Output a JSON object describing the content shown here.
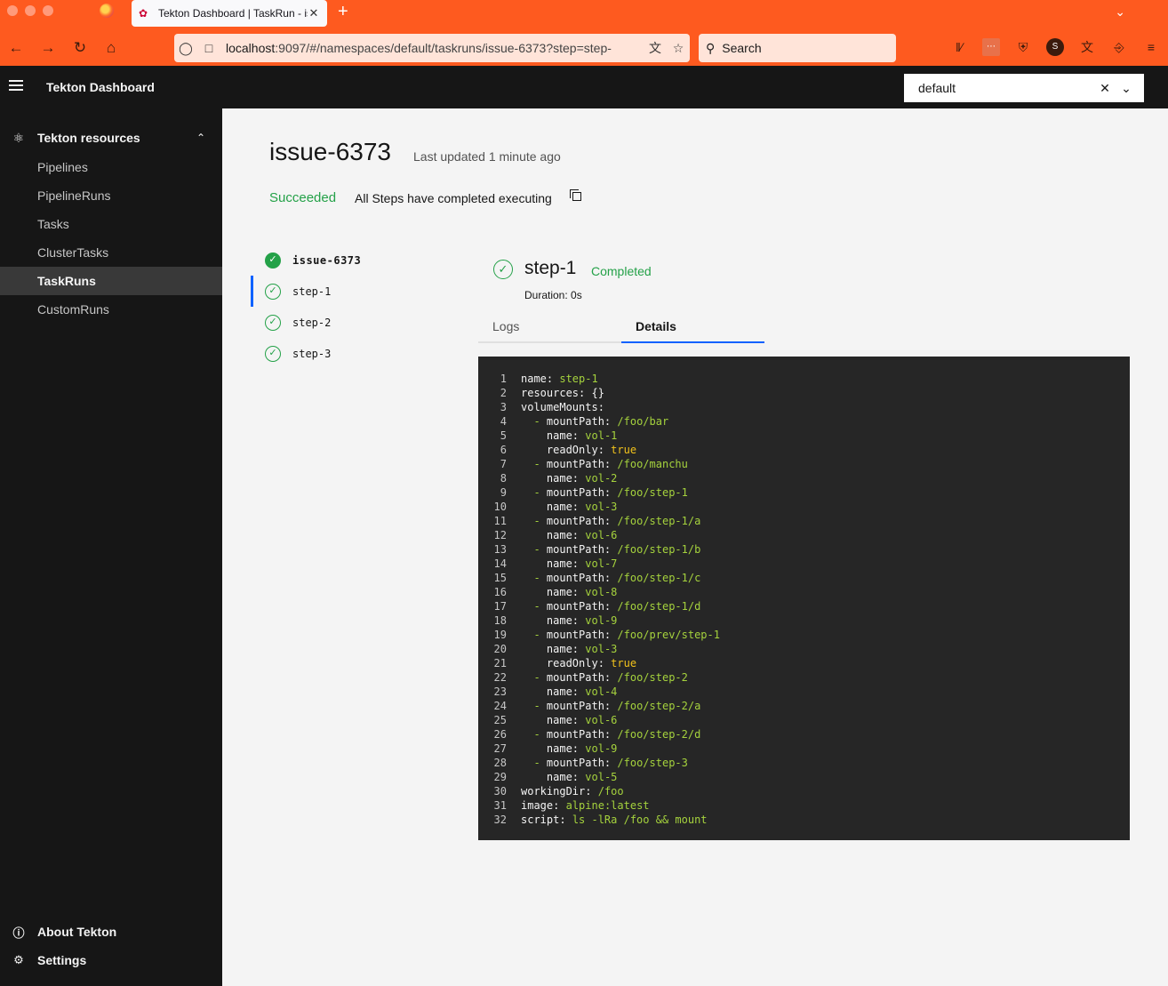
{
  "browser": {
    "tab_title": "Tekton Dashboard | TaskRun - is",
    "url_host": "localhost",
    "url_rest": ":9097/#/namespaces/default/taskruns/issue-6373?step=step-",
    "search_placeholder": "Search",
    "badge_count": "2",
    "profile_letter": "S"
  },
  "header": {
    "app_title": "Tekton Dashboard",
    "namespace": "default"
  },
  "sidebar": {
    "section_label": "Tekton resources",
    "items": [
      {
        "label": "Pipelines"
      },
      {
        "label": "PipelineRuns"
      },
      {
        "label": "Tasks"
      },
      {
        "label": "ClusterTasks"
      },
      {
        "label": "TaskRuns"
      },
      {
        "label": "CustomRuns"
      }
    ],
    "active_index": 4,
    "about_label": "About Tekton",
    "settings_label": "Settings"
  },
  "main": {
    "title": "issue-6373",
    "last_updated": "Last updated 1 minute ago",
    "status": "Succeeded",
    "status_message": "All Steps have completed executing",
    "tree": [
      {
        "label": "issue-6373"
      },
      {
        "label": "step-1"
      },
      {
        "label": "step-2"
      },
      {
        "label": "step-3"
      }
    ],
    "step": {
      "name": "step-1",
      "status": "Completed",
      "duration": "Duration: 0s"
    },
    "tabs": {
      "logs": "Logs",
      "details": "Details"
    }
  },
  "code_lines": [
    {
      "n": "1",
      "indent": "",
      "dash": "",
      "key": "name:",
      "val": "step-1",
      "t": "v"
    },
    {
      "n": "2",
      "indent": "",
      "dash": "",
      "key": "resources:",
      "val": "{}",
      "t": "k"
    },
    {
      "n": "3",
      "indent": "",
      "dash": "",
      "key": "volumeMounts:",
      "val": "",
      "t": "v"
    },
    {
      "n": "4",
      "indent": "  ",
      "dash": "- ",
      "key": "mountPath:",
      "val": "/foo/bar",
      "t": "v"
    },
    {
      "n": "5",
      "indent": "    ",
      "dash": "",
      "key": "name:",
      "val": "vol-1",
      "t": "v"
    },
    {
      "n": "6",
      "indent": "    ",
      "dash": "",
      "key": "readOnly:",
      "val": "true",
      "t": "b"
    },
    {
      "n": "7",
      "indent": "  ",
      "dash": "- ",
      "key": "mountPath:",
      "val": "/foo/manchu",
      "t": "v"
    },
    {
      "n": "8",
      "indent": "    ",
      "dash": "",
      "key": "name:",
      "val": "vol-2",
      "t": "v"
    },
    {
      "n": "9",
      "indent": "  ",
      "dash": "- ",
      "key": "mountPath:",
      "val": "/foo/step-1",
      "t": "v"
    },
    {
      "n": "10",
      "indent": "    ",
      "dash": "",
      "key": "name:",
      "val": "vol-3",
      "t": "v"
    },
    {
      "n": "11",
      "indent": "  ",
      "dash": "- ",
      "key": "mountPath:",
      "val": "/foo/step-1/a",
      "t": "v"
    },
    {
      "n": "12",
      "indent": "    ",
      "dash": "",
      "key": "name:",
      "val": "vol-6",
      "t": "v"
    },
    {
      "n": "13",
      "indent": "  ",
      "dash": "- ",
      "key": "mountPath:",
      "val": "/foo/step-1/b",
      "t": "v"
    },
    {
      "n": "14",
      "indent": "    ",
      "dash": "",
      "key": "name:",
      "val": "vol-7",
      "t": "v"
    },
    {
      "n": "15",
      "indent": "  ",
      "dash": "- ",
      "key": "mountPath:",
      "val": "/foo/step-1/c",
      "t": "v"
    },
    {
      "n": "16",
      "indent": "    ",
      "dash": "",
      "key": "name:",
      "val": "vol-8",
      "t": "v"
    },
    {
      "n": "17",
      "indent": "  ",
      "dash": "- ",
      "key": "mountPath:",
      "val": "/foo/step-1/d",
      "t": "v"
    },
    {
      "n": "18",
      "indent": "    ",
      "dash": "",
      "key": "name:",
      "val": "vol-9",
      "t": "v"
    },
    {
      "n": "19",
      "indent": "  ",
      "dash": "- ",
      "key": "mountPath:",
      "val": "/foo/prev/step-1",
      "t": "v"
    },
    {
      "n": "20",
      "indent": "    ",
      "dash": "",
      "key": "name:",
      "val": "vol-3",
      "t": "v"
    },
    {
      "n": "21",
      "indent": "    ",
      "dash": "",
      "key": "readOnly:",
      "val": "true",
      "t": "b"
    },
    {
      "n": "22",
      "indent": "  ",
      "dash": "- ",
      "key": "mountPath:",
      "val": "/foo/step-2",
      "t": "v"
    },
    {
      "n": "23",
      "indent": "    ",
      "dash": "",
      "key": "name:",
      "val": "vol-4",
      "t": "v"
    },
    {
      "n": "24",
      "indent": "  ",
      "dash": "- ",
      "key": "mountPath:",
      "val": "/foo/step-2/a",
      "t": "v"
    },
    {
      "n": "25",
      "indent": "    ",
      "dash": "",
      "key": "name:",
      "val": "vol-6",
      "t": "v"
    },
    {
      "n": "26",
      "indent": "  ",
      "dash": "- ",
      "key": "mountPath:",
      "val": "/foo/step-2/d",
      "t": "v"
    },
    {
      "n": "27",
      "indent": "    ",
      "dash": "",
      "key": "name:",
      "val": "vol-9",
      "t": "v"
    },
    {
      "n": "28",
      "indent": "  ",
      "dash": "- ",
      "key": "mountPath:",
      "val": "/foo/step-3",
      "t": "v"
    },
    {
      "n": "29",
      "indent": "    ",
      "dash": "",
      "key": "name:",
      "val": "vol-5",
      "t": "v"
    },
    {
      "n": "30",
      "indent": "",
      "dash": "",
      "key": "workingDir:",
      "val": "/foo",
      "t": "v"
    },
    {
      "n": "31",
      "indent": "",
      "dash": "",
      "key": "image:",
      "val": "alpine:latest",
      "t": "v"
    },
    {
      "n": "32",
      "indent": "",
      "dash": "",
      "key": "script:",
      "val": "ls -lRa /foo && mount",
      "t": "v"
    }
  ]
}
